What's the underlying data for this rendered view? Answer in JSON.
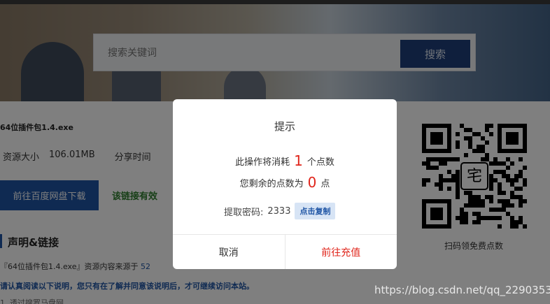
{
  "search": {
    "placeholder": "搜索关键词",
    "button_label": "搜索"
  },
  "file": {
    "name": "64位插件包1.4.exe",
    "size_label": "资源大小",
    "size_value": "106.01MB",
    "share_time_label": "分享时间"
  },
  "actions": {
    "download_label": "前往百度网盘下载",
    "link_status": "该链接有效"
  },
  "section": {
    "title": "声明&链接",
    "line1_prefix": "『64位插件包1.4.exe』资源内容来源于",
    "line1_highlight": "52",
    "line2": "请认真阅读以下说明，您只有在了解并同意该说明后，才可继续访问本站。",
    "line3": "1. 透过搜罗马盘网 ..."
  },
  "qr": {
    "caption": "扫码领免费点数",
    "center_glyph": "宅"
  },
  "modal": {
    "title": "提示",
    "cost_prefix": "此操作将消耗",
    "cost_value": "1",
    "cost_suffix": "个点数",
    "remaining_prefix": "您剩余的点数为",
    "remaining_value": "0",
    "remaining_suffix": "点",
    "password_label": "提取密码:",
    "password_value": "2333",
    "copy_label": "点击复制",
    "cancel_label": "取消",
    "recharge_label": "前往充值"
  },
  "watermark": "https://blog.csdn.net/qq_22903531",
  "colors": {
    "accent_blue": "#1f55a5",
    "search_button": "#1f3f7a",
    "highlight_red": "#e0251b",
    "link_green": "#2f7f2f"
  }
}
